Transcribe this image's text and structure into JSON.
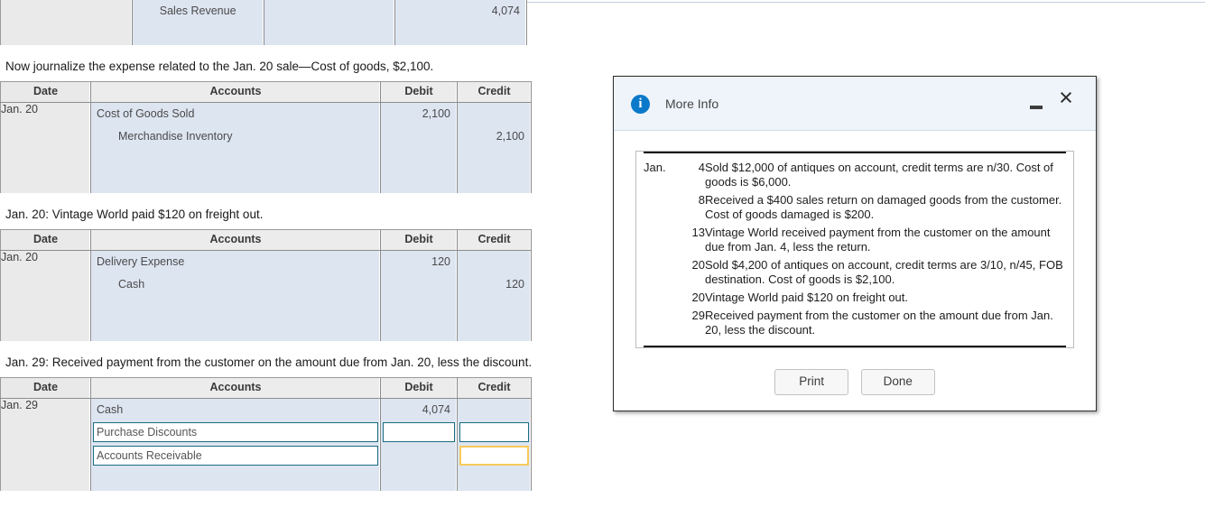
{
  "table_headers": [
    "Date",
    "Accounts",
    "Debit",
    "Credit"
  ],
  "sections": [
    {
      "name": "sales-revenue-partial",
      "prompt": null,
      "partial_top": true,
      "rows": [
        {
          "date": "",
          "account": "Sales Revenue",
          "indent": true,
          "debit": "",
          "credit": "4,074"
        },
        {
          "date": "",
          "account": "",
          "indent": false,
          "debit": "",
          "credit": ""
        }
      ]
    },
    {
      "name": "cost-of-goods",
      "prompt": "Now journalize the expense related to the Jan. 20 sale—Cost of goods, $2,100.",
      "rows": [
        {
          "date": "Jan. 20",
          "account": "Cost of Goods Sold",
          "indent": false,
          "debit": "2,100",
          "credit": ""
        },
        {
          "date": "",
          "account": "Merchandise Inventory",
          "indent": true,
          "debit": "",
          "credit": "2,100"
        },
        {
          "date": "",
          "account": "",
          "indent": false,
          "debit": "",
          "credit": ""
        },
        {
          "date": "",
          "account": "",
          "indent": false,
          "debit": "",
          "credit": ""
        }
      ]
    },
    {
      "name": "freight-out",
      "prompt": "Jan. 20: Vintage World paid $120 on freight out.",
      "rows": [
        {
          "date": "Jan. 20",
          "account": "Delivery Expense",
          "indent": false,
          "debit": "120",
          "credit": ""
        },
        {
          "date": "",
          "account": "Cash",
          "indent": true,
          "debit": "",
          "credit": "120"
        },
        {
          "date": "",
          "account": "",
          "indent": false,
          "debit": "",
          "credit": ""
        },
        {
          "date": "",
          "account": "",
          "indent": false,
          "debit": "",
          "credit": ""
        }
      ]
    },
    {
      "name": "payment-received",
      "prompt": "Jan. 29: Received payment from the customer on the amount due from Jan. 20, less the discount.",
      "rows": [
        {
          "date": "Jan. 29",
          "account": "Cash",
          "indent": false,
          "debit": "4,074",
          "credit": ""
        }
      ],
      "input_rows": [
        {
          "account_value": "Purchase Discounts",
          "account_focused": false,
          "debit_field": true,
          "debit_value": "",
          "debit_focused": false,
          "credit_field": true,
          "credit_value": "",
          "credit_focused": false
        },
        {
          "account_value": "Accounts Receivable",
          "account_focused": false,
          "debit_field": false,
          "debit_value": "",
          "debit_focused": false,
          "credit_field": true,
          "credit_value": "",
          "credit_focused": true
        }
      ]
    }
  ],
  "dialog": {
    "title": "More Info",
    "info_glyph": "i",
    "minimize_label": "Minimize",
    "close_glyph": "×",
    "month_label": "Jan.",
    "events": [
      {
        "day": "4",
        "text": "Sold $12,000 of antiques on account, credit terms are n/30. Cost of goods is $6,000."
      },
      {
        "day": "8",
        "text": "Received a $400 sales return on damaged goods from the customer. Cost of goods damaged is $200."
      },
      {
        "day": "13",
        "text": "Vintage World received payment from the customer on the amount due from Jan. 4, less the return."
      },
      {
        "day": "20",
        "text": "Sold $4,200 of antiques on account, credit terms are 3/10, n/45, FOB destination. Cost of goods is $2,100."
      },
      {
        "day": "20",
        "text": "Vintage World paid $120 on freight out."
      },
      {
        "day": "29",
        "text": "Received payment from the customer on the amount due from Jan. 20, less the discount."
      }
    ],
    "buttons": {
      "print": "Print",
      "done": "Done"
    }
  },
  "colors": {
    "row_blue": "#dde5f1",
    "date_gray": "#eaeaea",
    "header_gray": "#e9e9e9",
    "field_border": "#1b6d80",
    "field_focus_border": "#f6cb5a",
    "dialog_titlebar": "#eff4fb",
    "info_icon_blue": "#0a79c9"
  }
}
